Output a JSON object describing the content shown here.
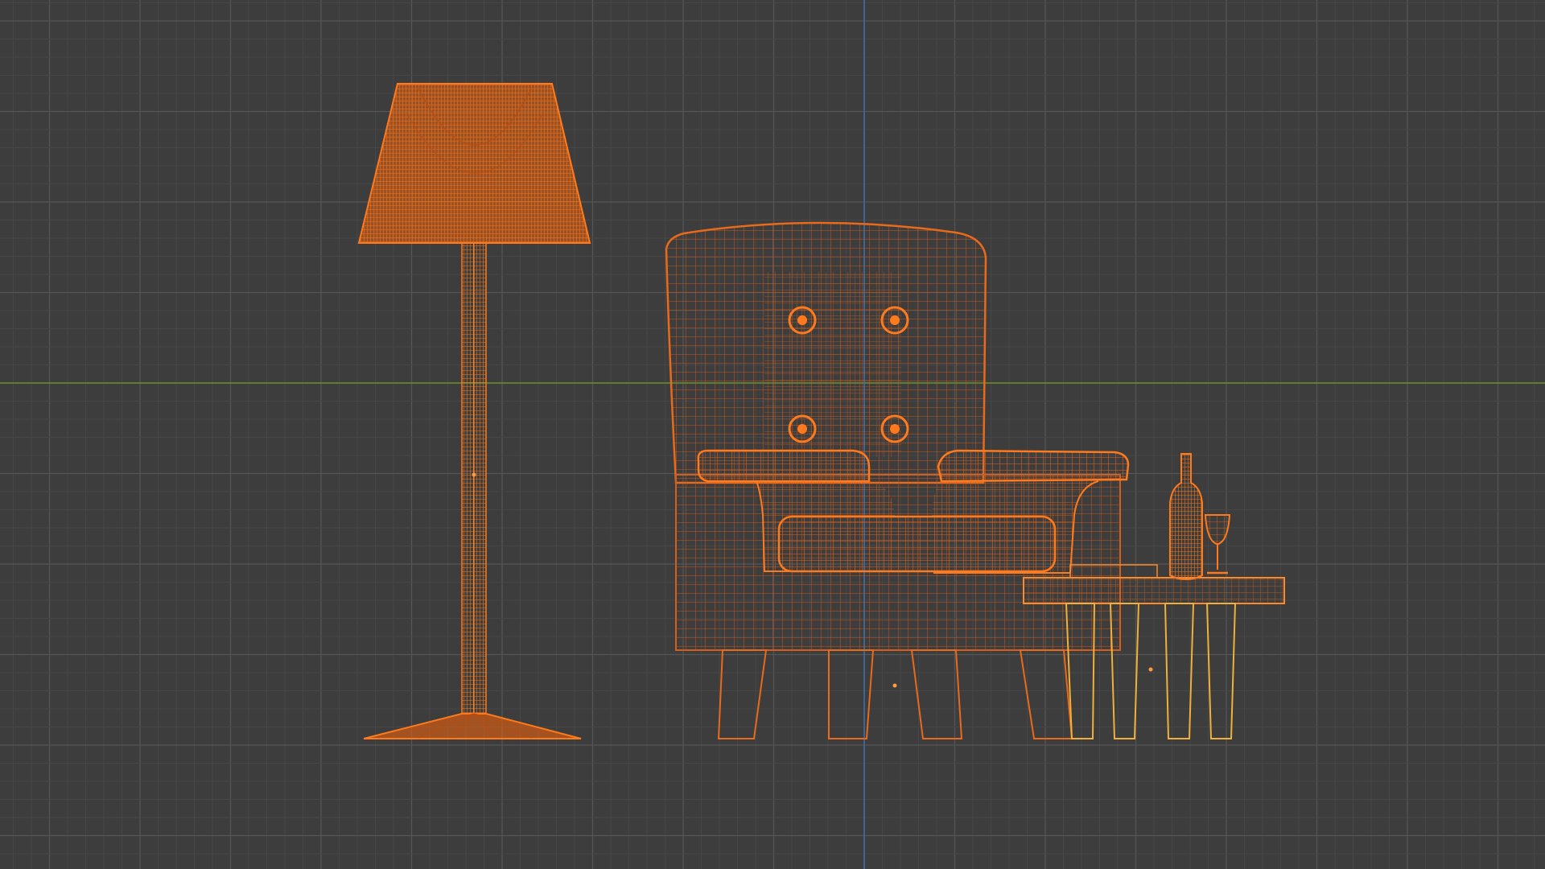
{
  "viewport": {
    "mode": "wireframe",
    "view": "front-orthographic",
    "background_color": "#3d3d3d",
    "grid": {
      "minor_color": "#474747",
      "major_color": "#555555",
      "x_axis_color": "#6a8f2a",
      "z_axis_color": "#3c6fb0"
    }
  },
  "scene": {
    "objects": [
      {
        "name": "floor-lamp",
        "icon": "lamp-icon",
        "wire_color": "#f06a10",
        "selected": true
      },
      {
        "name": "armchair",
        "icon": "armchair-icon",
        "wire_color": "#e2661a",
        "selected": true
      },
      {
        "name": "side-table",
        "icon": "table-icon",
        "wire_color": "#e8821a",
        "selected": true
      },
      {
        "name": "wine-bottle",
        "icon": "bottle-icon",
        "wire_color": "#e86a14",
        "selected": true
      },
      {
        "name": "wine-glass",
        "icon": "glass-icon",
        "wire_color": "#e86a14",
        "selected": true
      }
    ],
    "active_wire_color": "#ffb04a"
  }
}
